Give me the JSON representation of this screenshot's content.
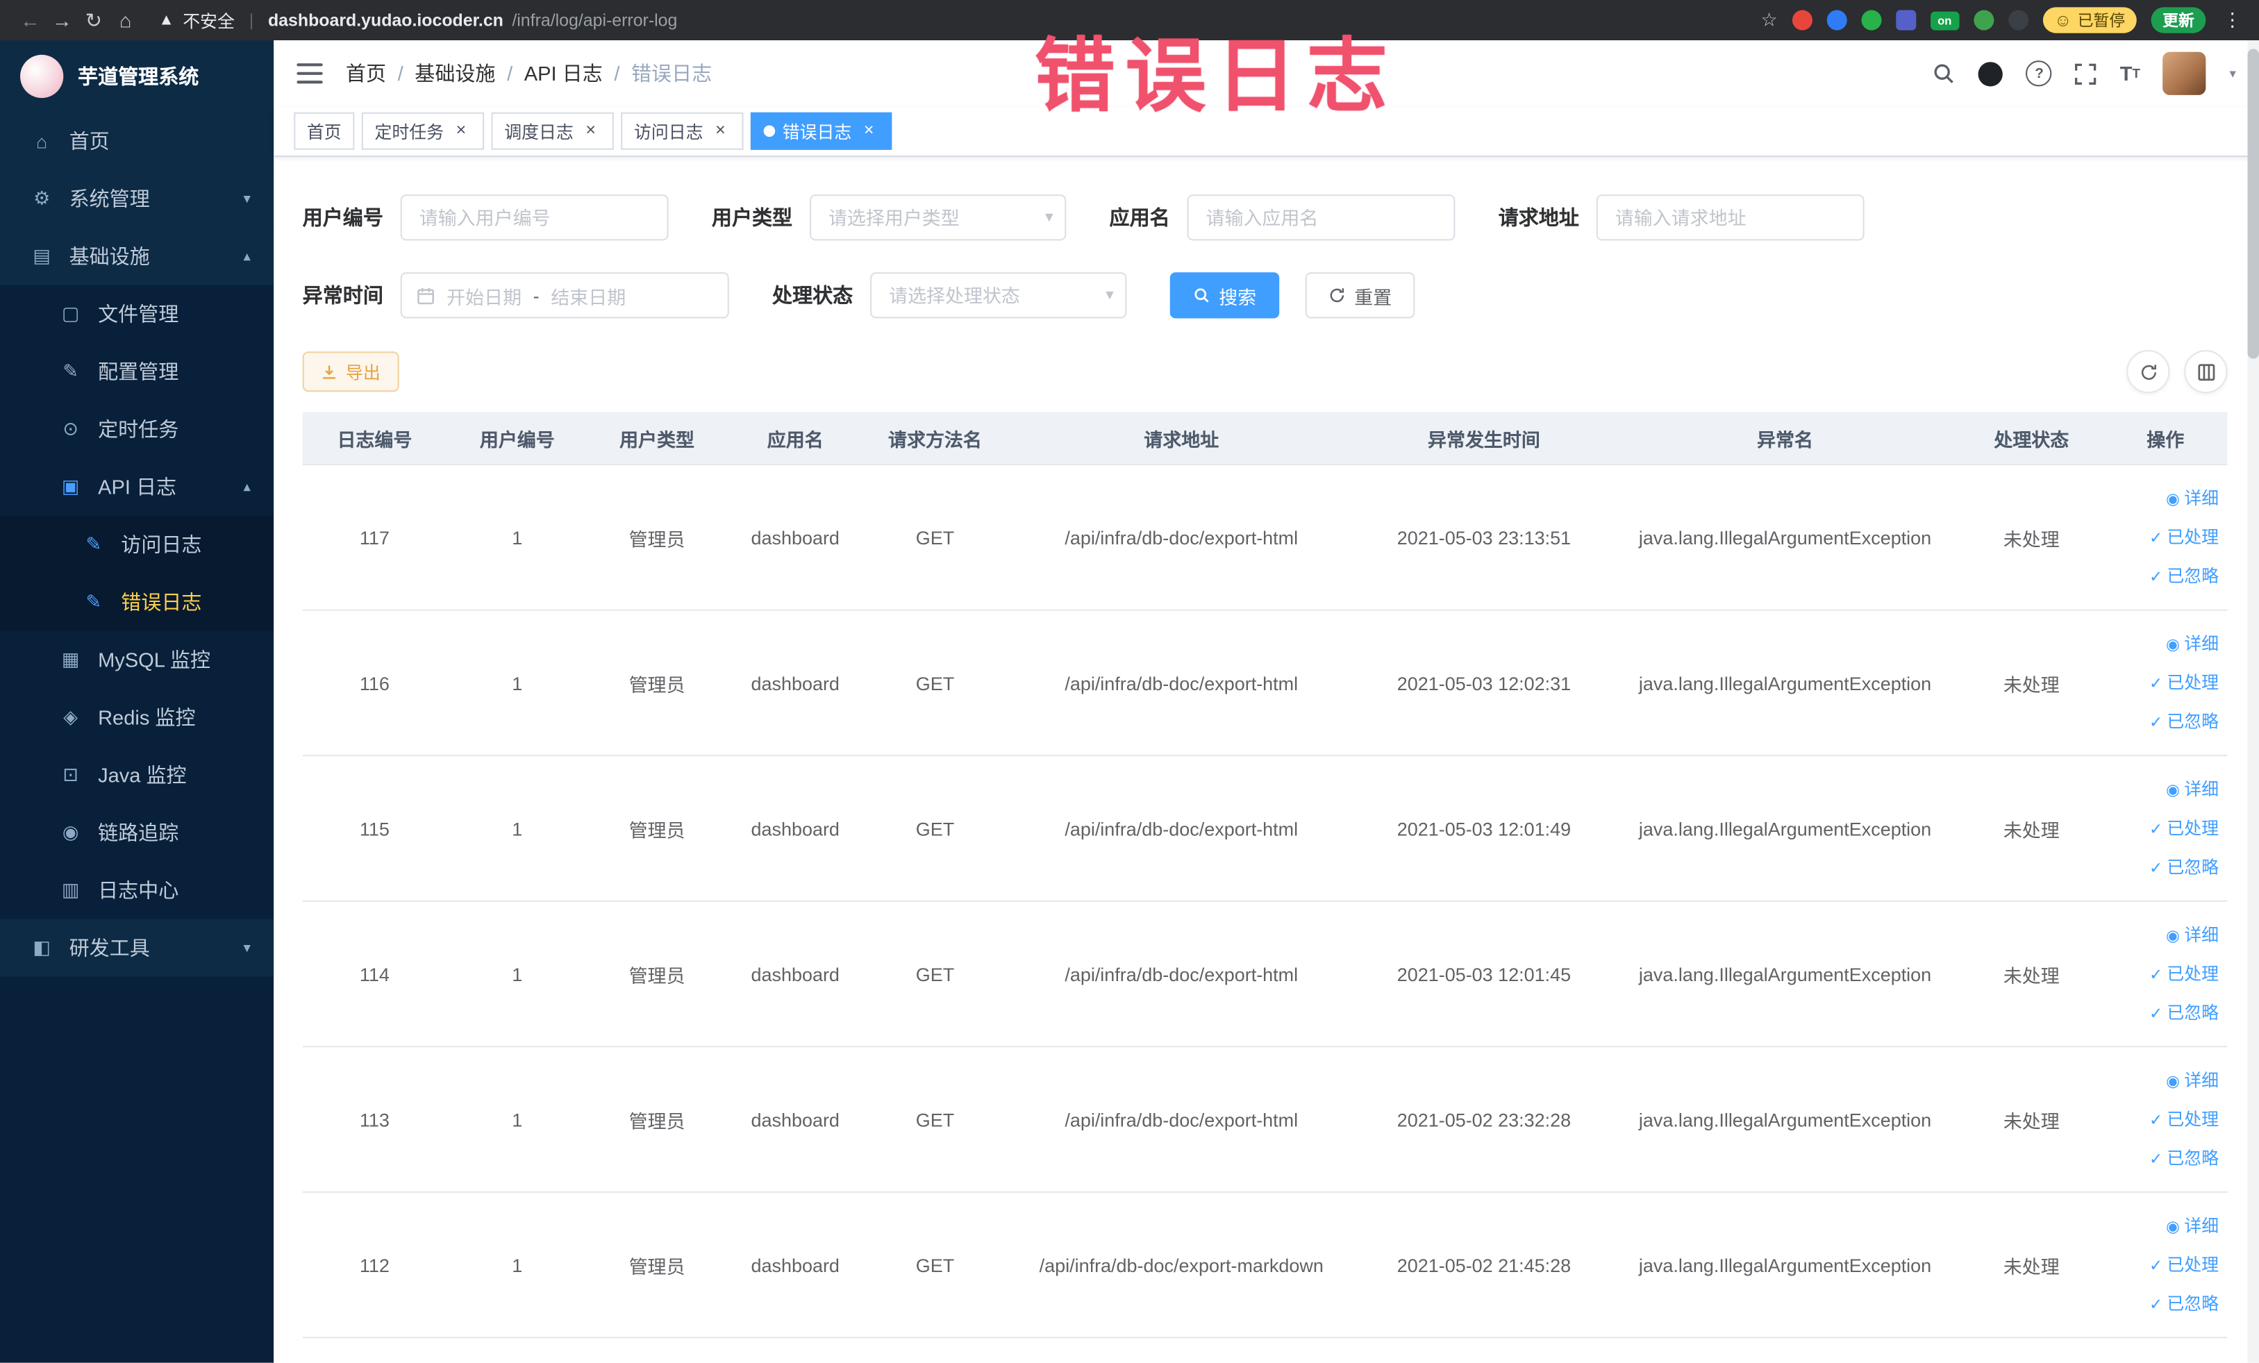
{
  "annotation": {
    "text": "错误日志"
  },
  "browser": {
    "security_label": "不安全",
    "url_host": "dashboard.yudao.iocoder.cn",
    "url_path": "/infra/log/api-error-log",
    "paused_badge": "已暂停",
    "update_label": "更新",
    "extensions": [
      {
        "name": "extension-red-icon",
        "color": "#e8453c",
        "shape": "circle"
      },
      {
        "name": "extension-blue-icon",
        "color": "#2f7cf6",
        "shape": "circle"
      },
      {
        "name": "extension-green-icon",
        "color": "#27b24a",
        "shape": "circle"
      },
      {
        "name": "extension-grid-icon",
        "color": "#5561c9",
        "shape": "square"
      },
      {
        "name": "extension-on-badge",
        "color": "#15a24a",
        "shape": "badge",
        "label": "on"
      },
      {
        "name": "extension-tree-icon",
        "color": "#3fa34d",
        "shape": "circle"
      },
      {
        "name": "extension-paw-icon",
        "color": "#3b4046",
        "shape": "circle"
      }
    ]
  },
  "sidebar": {
    "title": "芋道管理系统",
    "menu": [
      {
        "label": "首页",
        "level": 1,
        "icon": "home-icon"
      },
      {
        "label": "系统管理",
        "level": 1,
        "icon": "gear-icon",
        "chevron": "down"
      },
      {
        "label": "基础设施",
        "level": 1,
        "icon": "infrastructure-icon",
        "chevron": "up"
      },
      {
        "label": "文件管理",
        "level": 2,
        "icon": "file-icon"
      },
      {
        "label": "配置管理",
        "level": 2,
        "icon": "config-icon"
      },
      {
        "label": "定时任务",
        "level": 2,
        "icon": "timer-icon"
      },
      {
        "label": "API 日志",
        "level": 2,
        "icon": "api-log-icon",
        "chevron": "up"
      },
      {
        "label": "访问日志",
        "level": 3,
        "icon": "doc-icon"
      },
      {
        "label": "错误日志",
        "level": 3,
        "icon": "doc-icon",
        "active": true
      },
      {
        "label": "MySQL 监控",
        "level": 2,
        "icon": "mysql-icon"
      },
      {
        "label": "Redis 监控",
        "level": 2,
        "icon": "redis-icon"
      },
      {
        "label": "Java 监控",
        "level": 2,
        "icon": "java-icon"
      },
      {
        "label": "链路追踪",
        "level": 2,
        "icon": "trace-icon"
      },
      {
        "label": "日志中心",
        "level": 2,
        "icon": "log-center-icon"
      },
      {
        "label": "研发工具",
        "level": 1,
        "icon": "devtools-icon",
        "chevron": "down"
      }
    ]
  },
  "header": {
    "breadcrumb": [
      "首页",
      "基础设施",
      "API 日志",
      "错误日志"
    ]
  },
  "tabs": [
    {
      "label": "首页",
      "closable": false,
      "active": false
    },
    {
      "label": "定时任务",
      "closable": true,
      "active": false
    },
    {
      "label": "调度日志",
      "closable": true,
      "active": false
    },
    {
      "label": "访问日志",
      "closable": true,
      "active": false
    },
    {
      "label": "错误日志",
      "closable": true,
      "active": true
    }
  ],
  "filters": {
    "user_id": {
      "label": "用户编号",
      "placeholder": "请输入用户编号"
    },
    "user_type": {
      "label": "用户类型",
      "placeholder": "请选择用户类型"
    },
    "app_name": {
      "label": "应用名",
      "placeholder": "请输入应用名"
    },
    "request_url": {
      "label": "请求地址",
      "placeholder": "请输入请求地址"
    },
    "exception_time": {
      "label": "异常时间",
      "start_placeholder": "开始日期",
      "separator": "-",
      "end_placeholder": "结束日期"
    },
    "process_status": {
      "label": "处理状态",
      "placeholder": "请选择处理状态"
    },
    "search_button": "搜索",
    "reset_button": "重置"
  },
  "toolbar": {
    "export_button": "导出"
  },
  "table": {
    "columns": [
      "日志编号",
      "用户编号",
      "用户类型",
      "应用名",
      "请求方法名",
      "请求地址",
      "异常发生时间",
      "异常名",
      "处理状态",
      "操作"
    ],
    "actions": [
      "详细",
      "已处理",
      "已忽略"
    ],
    "rows": [
      {
        "id": "117",
        "user_id": "1",
        "user_type": "管理员",
        "app": "dashboard",
        "method": "GET",
        "url": "/api/infra/db-doc/export-html",
        "time": "2021-05-03 23:13:51",
        "exception": "java.lang.IllegalArgumentException",
        "status": "未处理"
      },
      {
        "id": "116",
        "user_id": "1",
        "user_type": "管理员",
        "app": "dashboard",
        "method": "GET",
        "url": "/api/infra/db-doc/export-html",
        "time": "2021-05-03 12:02:31",
        "exception": "java.lang.IllegalArgumentException",
        "status": "未处理"
      },
      {
        "id": "115",
        "user_id": "1",
        "user_type": "管理员",
        "app": "dashboard",
        "method": "GET",
        "url": "/api/infra/db-doc/export-html",
        "time": "2021-05-03 12:01:49",
        "exception": "java.lang.IllegalArgumentException",
        "status": "未处理"
      },
      {
        "id": "114",
        "user_id": "1",
        "user_type": "管理员",
        "app": "dashboard",
        "method": "GET",
        "url": "/api/infra/db-doc/export-html",
        "time": "2021-05-03 12:01:45",
        "exception": "java.lang.IllegalArgumentException",
        "status": "未处理"
      },
      {
        "id": "113",
        "user_id": "1",
        "user_type": "管理员",
        "app": "dashboard",
        "method": "GET",
        "url": "/api/infra/db-doc/export-html",
        "time": "2021-05-02 23:32:28",
        "exception": "java.lang.IllegalArgumentException",
        "status": "未处理"
      },
      {
        "id": "112",
        "user_id": "1",
        "user_type": "管理员",
        "app": "dashboard",
        "method": "GET",
        "url": "/api/infra/db-doc/export-markdown",
        "time": "2021-05-02 21:45:28",
        "exception": "java.lang.IllegalArgumentException",
        "status": "未处理"
      }
    ]
  }
}
